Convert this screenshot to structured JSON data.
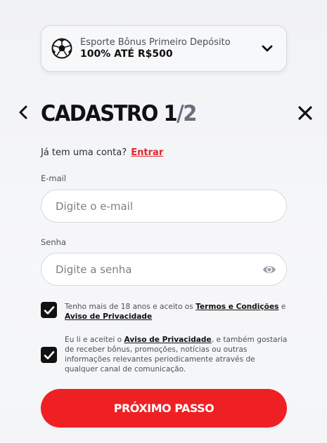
{
  "bonus": {
    "icon": "soccer-ball-icon",
    "subtitle": "Esporte Bônus Primeiro Depósito",
    "title": "100% ATÉ R$500",
    "toggle_icon": "chevron-down-icon"
  },
  "header": {
    "back_icon": "chevron-left-icon",
    "title_prefix": "CADASTRO 1",
    "title_suffix": "/2",
    "close_icon": "close-icon"
  },
  "login": {
    "question": "Já tem uma conta?",
    "link": "Entrar"
  },
  "email": {
    "label": "E-mail",
    "placeholder": "Digite o e-mail",
    "value": ""
  },
  "password": {
    "label": "Senha",
    "placeholder": "Digite a senha",
    "value": "",
    "toggle_icon": "eye-icon"
  },
  "consent_age": {
    "checked": true,
    "text_before": "Tenho mais de 18 anos e aceito os ",
    "link_terms": "Termos e Condições",
    "text_mid": " e ",
    "link_privacy": "Aviso de Privacidade"
  },
  "consent_marketing": {
    "checked": true,
    "text_before": "Eu li e aceitei o ",
    "link_privacy": "Aviso de Privacidade",
    "text_after": ", e também gostaria de receber bônus, promoções, notícias ou outras informações relevantes periodicamente através de qualquer canal de comunicação."
  },
  "next_button": {
    "label": "PRÓXIMO PASSO"
  },
  "colors": {
    "accent": "#ef2024",
    "link_red": "#e0252b",
    "checkbox": "#111111"
  }
}
